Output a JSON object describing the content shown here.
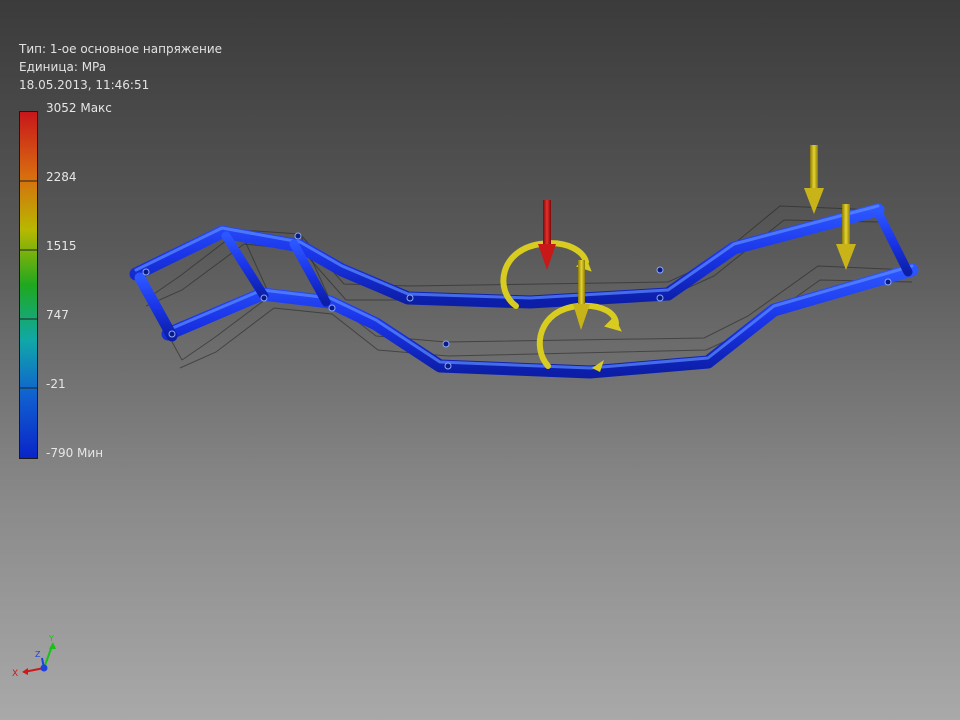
{
  "result_info": {
    "type_line": "Тип: 1-ое основное напряжение",
    "unit_line": "Единица: MPa",
    "date_line": "18.05.2013, 11:46:51"
  },
  "legend": {
    "labels": [
      "3052 Макс",
      "2284",
      "1515",
      "747",
      "-21",
      "-790 Мин"
    ],
    "colors": [
      "#c8161a",
      "#d86a10",
      "#b8b800",
      "#1fa81f",
      "#10a8a8",
      "#1060d0",
      "#0a24c8"
    ]
  },
  "model": {
    "beam_color": "#1a3cf0",
    "beam_highlight": "#6aa0ff",
    "load_arrow_colors": [
      "#d4c018",
      "#c81818"
    ],
    "moment_color": "#d8cc20"
  },
  "triad": {
    "x_label": "X",
    "y_label": "Y",
    "z_label": "Z",
    "x_color": "#d01818",
    "y_color": "#18c018",
    "z_color": "#2040e0"
  }
}
